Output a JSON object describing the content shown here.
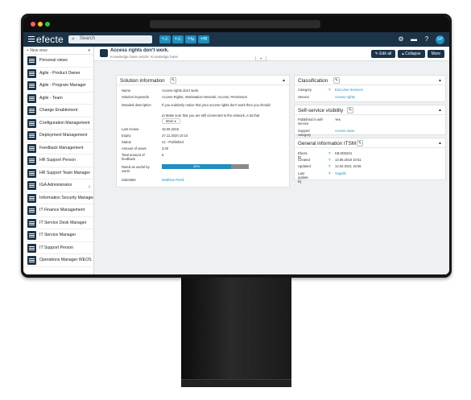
{
  "app": {
    "logo": "efecte",
    "search_placeholder": "Search",
    "avatar_initials": "SP"
  },
  "header": {
    "create_buttons": [
      "+⚠",
      "+⚠",
      "+⇆",
      "+✉"
    ],
    "icons": [
      "gear-icon",
      "folder-icon",
      "help-icon"
    ]
  },
  "sidebar": {
    "new_view": "New view",
    "items": [
      "Personal views",
      "Agile - Product Owner",
      "Agile - Program Manager",
      "Agile - Team",
      "Change Enablement",
      "Configuration Management",
      "Deployment Management",
      "Feedback Management",
      "HR Support Person",
      "HR Support Team Manager",
      "IGA Administrator",
      "Information Security Management",
      "IT Finance Management",
      "IT Service Desk Manager",
      "IT Service Manager",
      "IT Support Person",
      "Operations Manager WEOS"
    ]
  },
  "page": {
    "title": "Access rights don't work.",
    "subtitle": "Knowledge base article: Knowledge base",
    "actions": {
      "edit_all": "Edit all",
      "collapse": "Collapse",
      "more": "More"
    }
  },
  "solution": {
    "title": "Solution information",
    "rows": [
      {
        "k": "Name",
        "v": "Access rights don't work."
      },
      {
        "k": "Solution keywords",
        "v": "Access Rights, Workstation Network, Access, Permission"
      },
      {
        "k": "Detailed description",
        "v": "If you suddenly notice that your access rights don't work then you should:"
      },
      {
        "k": "",
        "v": "a) Make sure that you are still connected to the network, a lot that"
      }
    ],
    "more_label": "More",
    "rows2": [
      {
        "k": "Last review",
        "v": "15.06.2018"
      },
      {
        "k": "Expiry",
        "v": "27.11.2020 10:10"
      },
      {
        "k": "Status",
        "v": "21 - Published"
      },
      {
        "k": "Amount of views",
        "v": "3,00"
      },
      {
        "k": "Total amount of feedback",
        "v": "5"
      },
      {
        "k": "Rated as useful by users",
        "v": ""
      },
      {
        "k": "Submitter",
        "v": "Matthias Persli"
      }
    ],
    "progress_label": "80%",
    "progress_value": 0.8
  },
  "classification": {
    "title": "Classification",
    "rows": [
      {
        "k": "Category",
        "v": "End User Services"
      },
      {
        "k": "Service",
        "v": "Access rights"
      }
    ]
  },
  "selfservice": {
    "title": "Self-service visibility",
    "rows": [
      {
        "k": "Published in self-service",
        "v": "Yes"
      },
      {
        "k": "Support category",
        "v": "Access issue"
      }
    ]
  },
  "general": {
    "title": "General information ITSM",
    "rows": [
      {
        "k": "Efecte ID",
        "v": "KB-000234"
      },
      {
        "k": "Created",
        "v": "13.06.2018 10:51"
      },
      {
        "k": "Updated",
        "v": "12.02.2021 15:06"
      },
      {
        "k": "Last update by",
        "v": "Vogelth"
      }
    ]
  },
  "colors": {
    "navy": "#1c3448",
    "accent": "#1f8fbf"
  }
}
